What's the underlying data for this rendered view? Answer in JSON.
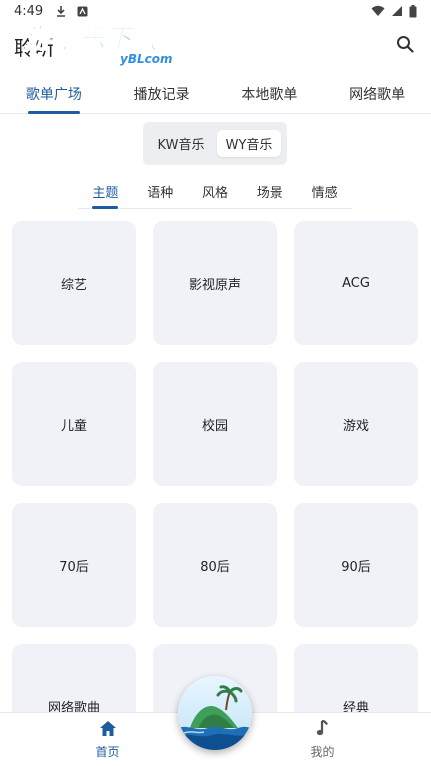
{
  "status": {
    "time": "4:49"
  },
  "app": {
    "title": "聆听",
    "watermark_main": "游吧乐下载",
    "watermark_sub": "yBLcom"
  },
  "top_tabs": [
    {
      "label": "歌单广场",
      "active": true
    },
    {
      "label": "播放记录",
      "active": false
    },
    {
      "label": "本地歌单",
      "active": false
    },
    {
      "label": "网络歌单",
      "active": false
    }
  ],
  "source": {
    "options": [
      "KW音乐",
      "WY音乐"
    ],
    "selected": "WY音乐"
  },
  "sub_tabs": [
    {
      "label": "主题",
      "active": true
    },
    {
      "label": "语种",
      "active": false
    },
    {
      "label": "风格",
      "active": false
    },
    {
      "label": "场景",
      "active": false
    },
    {
      "label": "情感",
      "active": false
    }
  ],
  "categories": [
    "综艺",
    "影视原声",
    "ACG",
    "儿童",
    "校园",
    "游戏",
    "70后",
    "80后",
    "90后",
    "网络歌曲",
    "",
    "经典"
  ],
  "bottom_nav": [
    {
      "label": "首页",
      "icon": "home-icon",
      "active": true
    },
    {
      "label": "我的",
      "icon": "music-note-icon",
      "active": false
    }
  ],
  "colors": {
    "accent": "#1e5c9e",
    "card_bg": "#f0f2f7"
  }
}
